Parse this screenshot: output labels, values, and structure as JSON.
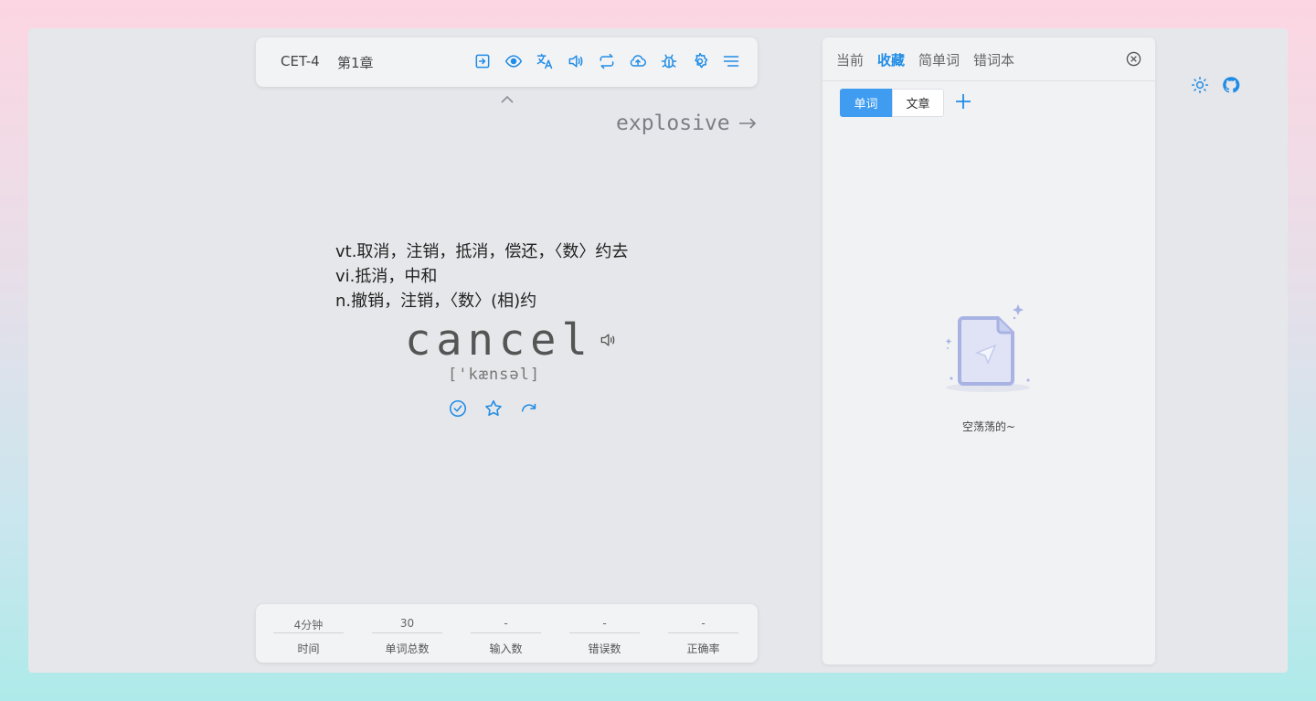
{
  "toolbar": {
    "dict": "CET-4",
    "chapter": "第1章",
    "icons": [
      "exit-icon",
      "eye-icon",
      "translate-icon",
      "speaker-icon",
      "loop-icon",
      "cloud-upload-icon",
      "bug-icon",
      "gear-icon",
      "menu-icon"
    ]
  },
  "next_word": {
    "word": "explosive"
  },
  "current": {
    "definitions": [
      "vt.取消，注销，抵消，偿还，〈数〉约去",
      "vi.抵消，中和",
      "n.撤销，注销，〈数〉(相)约"
    ],
    "word": "cancel",
    "phonetic": "['kænsəl]"
  },
  "stats": [
    {
      "value": "4分钟",
      "label": "时间"
    },
    {
      "value": "30",
      "label": "单词总数"
    },
    {
      "value": "-",
      "label": "输入数"
    },
    {
      "value": "-",
      "label": "错误数"
    },
    {
      "value": "-",
      "label": "正确率"
    }
  ],
  "panel": {
    "tabs": [
      "当前",
      "收藏",
      "简单词",
      "错词本"
    ],
    "active_tab": "收藏",
    "segments": [
      "单词",
      "文章"
    ],
    "empty_text": "空荡荡的~"
  },
  "colors": {
    "accent": "#1f8ce6",
    "segment_active": "#3f9cf0"
  }
}
